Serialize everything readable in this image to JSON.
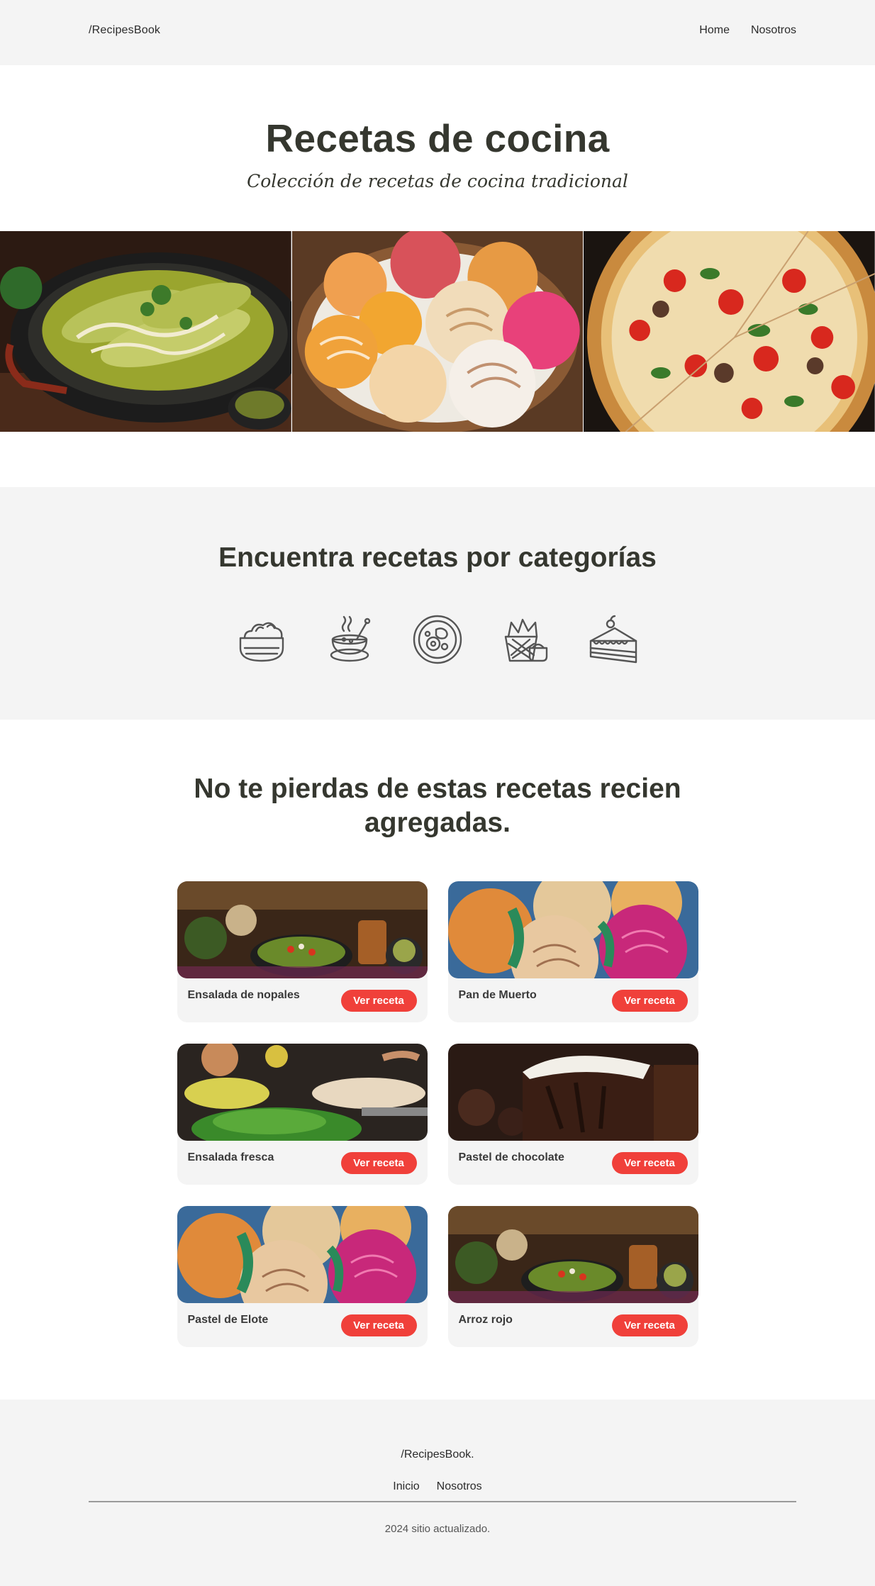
{
  "header": {
    "logo": "/RecipesBook",
    "nav": [
      "Home",
      "Nosotros"
    ]
  },
  "hero": {
    "title": "Recetas de cocina",
    "subtitle": "Colección de recetas de cocina tradicional"
  },
  "banner_images": [
    "enchiladas-image",
    "pan-dulce-image",
    "pizza-image"
  ],
  "categories": {
    "title": "Encuentra recetas por categorías",
    "icons": [
      "salad-bowl-icon",
      "soup-icon",
      "plate-icon",
      "snacks-icon",
      "cake-slice-icon"
    ]
  },
  "recipes": {
    "title": "No te pierdas de estas recetas recien agregadas.",
    "button_label": "Ver receta",
    "items": [
      {
        "name": "Ensalada de nopales"
      },
      {
        "name": "Pan de Muerto"
      },
      {
        "name": "Ensalada fresca"
      },
      {
        "name": "Pastel de chocolate"
      },
      {
        "name": "Pastel de Elote"
      },
      {
        "name": "Arroz rojo"
      }
    ]
  },
  "footer": {
    "logo": "/RecipesBook.",
    "nav": [
      "Inicio",
      "Nosotros"
    ],
    "copyright": "2024 sitio actualizado."
  },
  "colors": {
    "accent": "#f0403a",
    "text": "#35372f",
    "panel": "#f4f4f4"
  }
}
